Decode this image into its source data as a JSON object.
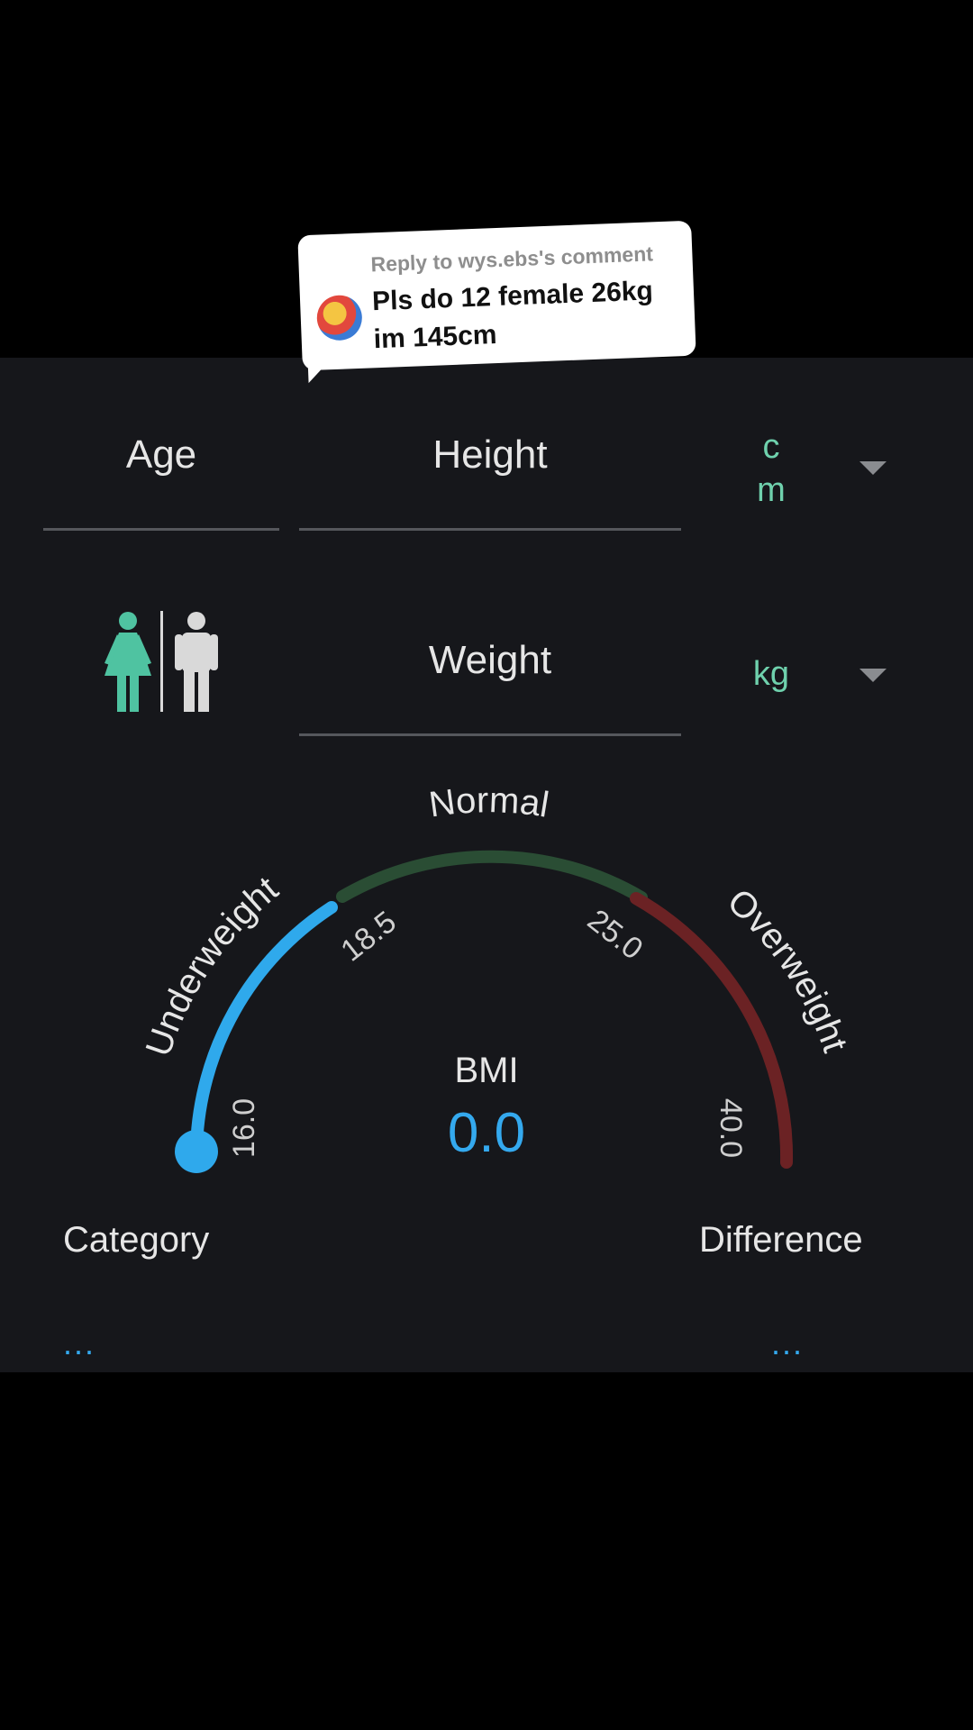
{
  "comment": {
    "reply_header": "Reply to wys.ebs's comment",
    "text": "Pls do 12 female 26kg im 145cm"
  },
  "form": {
    "age_label": "Age",
    "height_label": "Height",
    "height_unit": "cm",
    "weight_label": "Weight",
    "weight_unit": "kg"
  },
  "gender": {
    "selected": "female",
    "female_color": "#4fc3a1",
    "male_color": "#d9d9d9"
  },
  "gauge": {
    "labels": {
      "underweight": "Underweight",
      "normal": "Normal",
      "overweight": "Overweight"
    },
    "ticks": [
      "16.0",
      "18.5",
      "25.0",
      "40.0"
    ],
    "bmi_label": "BMI",
    "bmi_value": "0.0",
    "colors": {
      "underweight": "#2fa9ec",
      "normal": "#2a4d34",
      "overweight": "#6b2224"
    }
  },
  "results": {
    "category_label": "Category",
    "category_value": "...",
    "difference_label": "Difference",
    "difference_value": "..."
  }
}
